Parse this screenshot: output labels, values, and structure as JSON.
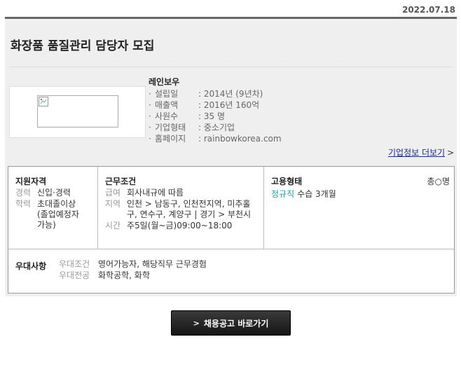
{
  "posting_date": "2022.07.18",
  "job_title": "화장품 품질관리 담당자 모집",
  "company": {
    "name": "레인보우",
    "bullet": "·",
    "info": [
      {
        "label": "설립일",
        "value": ": 2014년 (9년차)"
      },
      {
        "label": "매출액",
        "value": ": 2016년 160억"
      },
      {
        "label": "사원수",
        "value": ": 35 명"
      },
      {
        "label": "기업형태",
        "value": ": 중소기업"
      },
      {
        "label": "홈페이지",
        "value": ": rainbowkorea.com"
      }
    ],
    "more_link": "기업정보 더보기",
    "more_chevron": ">"
  },
  "qualification": {
    "title": "지원자격",
    "rows": [
      {
        "k": "경력",
        "v": "신입·경력"
      },
      {
        "k": "학력",
        "v": "초대졸이상 (졸업예정자 가능)"
      }
    ]
  },
  "work_conditions": {
    "title": "근무조건",
    "rows": [
      {
        "k": "급여",
        "v": "회사내규에 따름"
      },
      {
        "k": "지역",
        "v": "인천 > 남동구, 인천전지역, 미추홀구, 연수구, 계양구 | 경기 > 부천시"
      },
      {
        "k": "시간",
        "v": "주5일(월~금)09:00~18:00"
      }
    ]
  },
  "employment": {
    "title": "고용형태",
    "type": "정규직",
    "probation": "수습 3개월",
    "headcount": "총○명"
  },
  "preferences": {
    "title": "우대사항",
    "rows": [
      {
        "k": "우대조건",
        "v": "영어가능자, 해당직무 근무경험"
      },
      {
        "k": "우대전공",
        "v": "화학공학, 화학"
      }
    ]
  },
  "cta": {
    "label": "채용공고 바로가기",
    "chevron": ">"
  },
  "colors": {
    "accent": "#1b9aa0",
    "link": "#1a2a8a",
    "panel": "#efefef"
  }
}
